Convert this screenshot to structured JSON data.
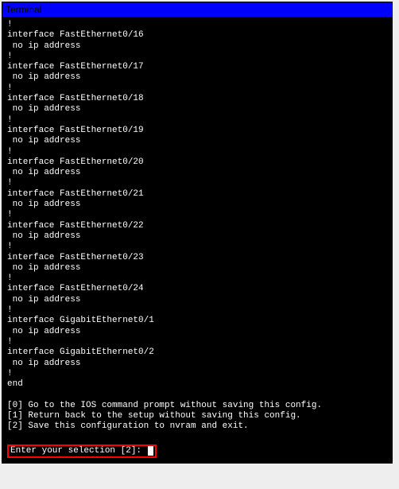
{
  "window": {
    "title": "Terminal"
  },
  "interfaces": [
    {
      "bang": "!",
      "name": "interface FastEthernet0/16",
      "config": " no ip address"
    },
    {
      "bang": "!",
      "name": "interface FastEthernet0/17",
      "config": " no ip address"
    },
    {
      "bang": "!",
      "name": "interface FastEthernet0/18",
      "config": " no ip address"
    },
    {
      "bang": "!",
      "name": "interface FastEthernet0/19",
      "config": " no ip address"
    },
    {
      "bang": "!",
      "name": "interface FastEthernet0/20",
      "config": " no ip address"
    },
    {
      "bang": "!",
      "name": "interface FastEthernet0/21",
      "config": " no ip address"
    },
    {
      "bang": "!",
      "name": "interface FastEthernet0/22",
      "config": " no ip address"
    },
    {
      "bang": "!",
      "name": "interface FastEthernet0/23",
      "config": " no ip address"
    },
    {
      "bang": "!",
      "name": "interface FastEthernet0/24",
      "config": " no ip address"
    },
    {
      "bang": "!",
      "name": "interface GigabitEthernet0/1",
      "config": " no ip address"
    },
    {
      "bang": "!",
      "name": "interface GigabitEthernet0/2",
      "config": " no ip address"
    }
  ],
  "trailing_bang": "!",
  "end_line": "end",
  "menu": {
    "opt0": "[0] Go to the IOS command prompt without saving this config.",
    "opt1": "[1] Return back to the setup without saving this config.",
    "opt2": "[2] Save this configuration to nvram and exit."
  },
  "prompt": {
    "label": "Enter your selection [2]: "
  }
}
